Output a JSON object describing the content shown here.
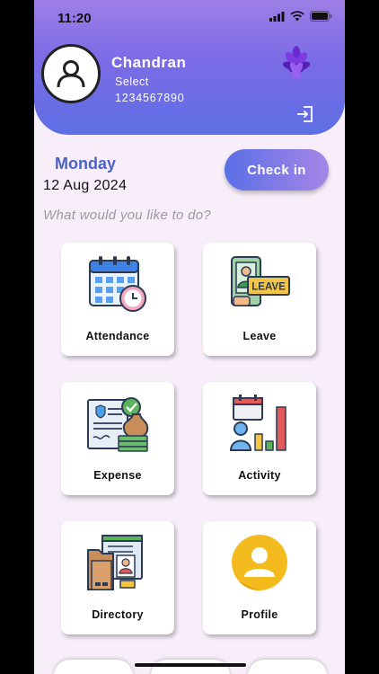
{
  "status_bar": {
    "time": "11:20"
  },
  "profile": {
    "name": "Chandran",
    "role": "Select",
    "phone": "1234567890"
  },
  "today": {
    "day": "Monday",
    "date": "12 Aug 2024"
  },
  "checkin_label": "Check in",
  "prompt": "What would you like to do?",
  "menu": [
    {
      "label": "Attendance",
      "icon": "calendar-clock-icon"
    },
    {
      "label": "Leave",
      "icon": "leave-sign-icon"
    },
    {
      "label": "Expense",
      "icon": "expense-document-icon"
    },
    {
      "label": "Activity",
      "icon": "activity-chart-icon"
    },
    {
      "label": "Directory",
      "icon": "folder-contact-icon"
    },
    {
      "label": "Profile",
      "icon": "profile-user-icon"
    }
  ],
  "colors": {
    "header_top": "#9d7fe6",
    "header_bottom": "#5d6fe4",
    "accent": "#4b63c8",
    "background": "#f7eefa"
  }
}
